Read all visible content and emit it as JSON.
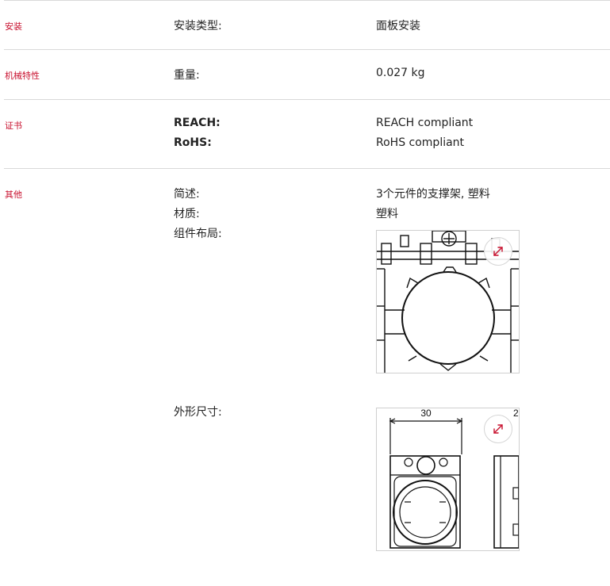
{
  "rows": [
    {
      "category": "安装",
      "label": "安装类型:",
      "value": "面板安装"
    },
    {
      "category": "机械特性",
      "label": "重量:",
      "value": "0.027 kg"
    },
    {
      "category": "证书",
      "label1": "REACH:",
      "value1": "REACH compliant",
      "label2": "RoHS:",
      "value2": "RoHS compliant"
    },
    {
      "category": "其他",
      "label1": "简述:",
      "value1": "3个元件的支撑架, 塑料",
      "label2": "材质:",
      "value2": "塑料",
      "label3": "组件布局:",
      "label4": "外形尺寸:"
    }
  ],
  "dimension_drawing": {
    "width_label": "30",
    "side_label": "2"
  },
  "icons": {
    "zoom": "expand-arrows-icon"
  },
  "colors": {
    "accent": "#c8102e",
    "divider": "#d9d9d9",
    "text": "#222222"
  }
}
